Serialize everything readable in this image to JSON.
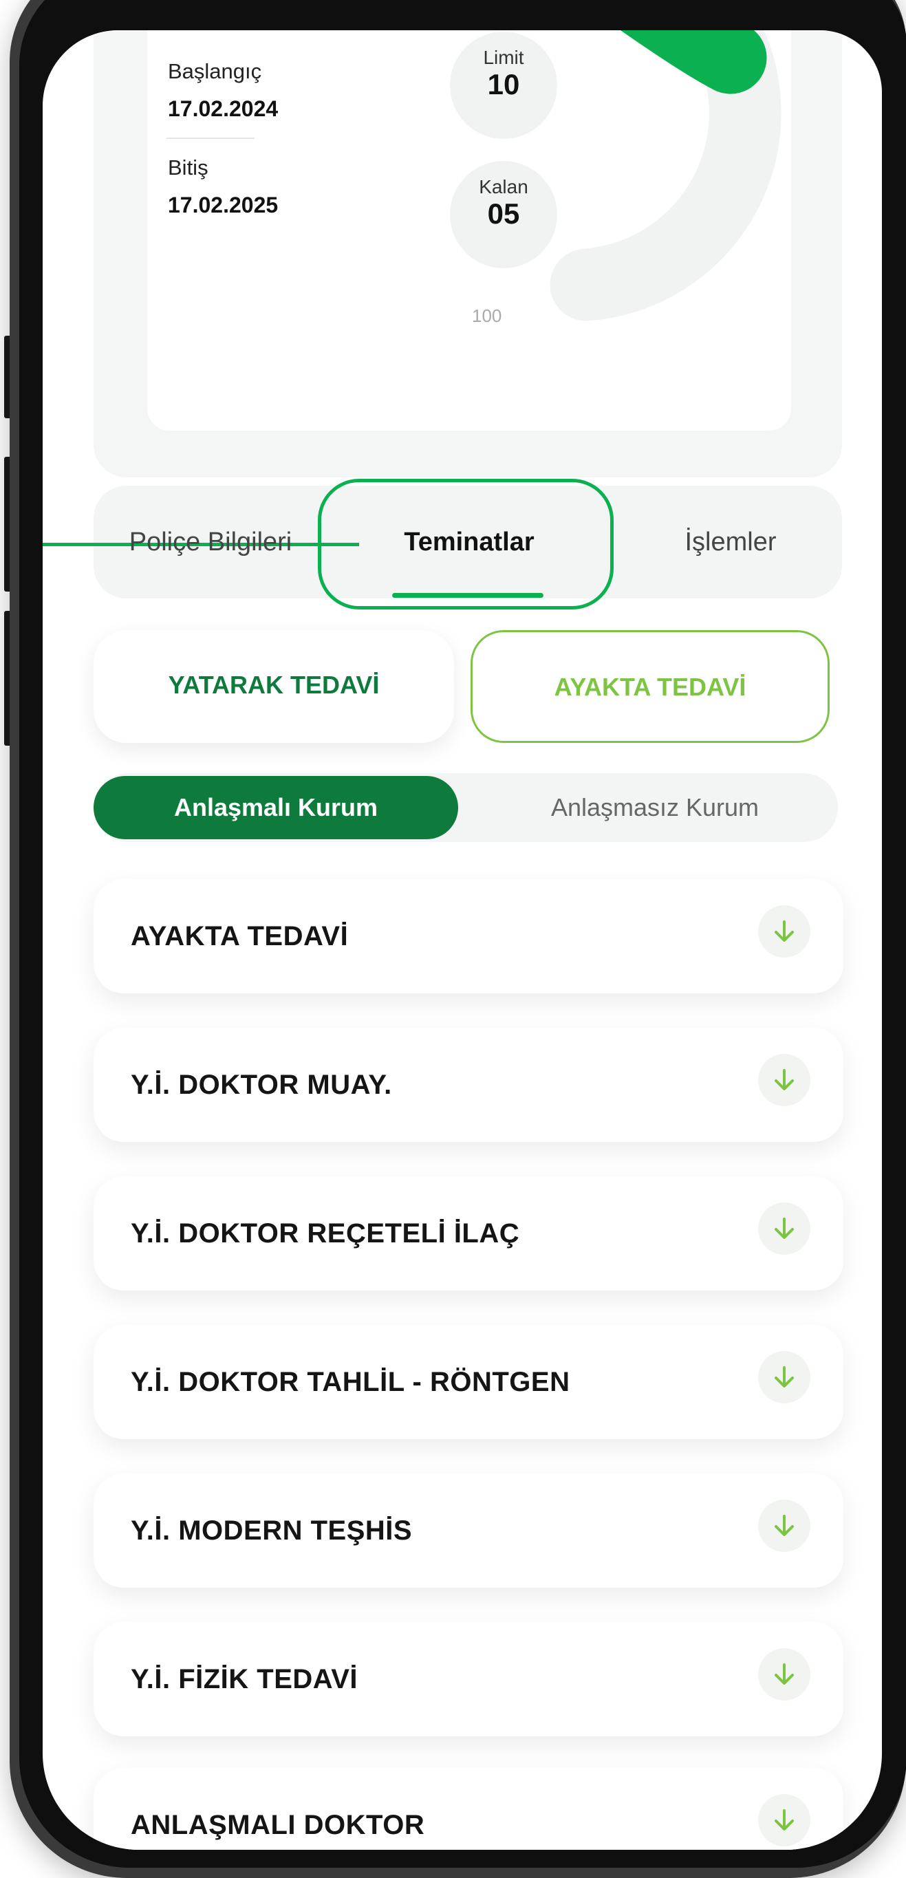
{
  "policy": {
    "start_label": "Başlangıç",
    "start_date": "17.02.2024",
    "end_label": "Bitiş",
    "end_date": "17.02.2025",
    "limit_label": "Limit",
    "limit_value": "10",
    "remaining_label": "Kalan",
    "remaining_value": "05",
    "gauge_max_label": "100",
    "gauge_fill_fraction": 0.15
  },
  "tabs": [
    {
      "label": "Poliçe Bilgileri",
      "active": false
    },
    {
      "label": "Teminatlar",
      "active": true
    },
    {
      "label": "İşlemler",
      "active": false
    }
  ],
  "treatment": {
    "inpatient_label": "YATARAK TEDAVİ",
    "outpatient_label": "AYAKTA TEDAVİ",
    "selected": "AYAKTA TEDAVİ"
  },
  "institution": {
    "contracted_label": "Anlaşmalı Kurum",
    "non_contracted_label": "Anlaşmasız Kurum",
    "selected": "Anlaşmalı Kurum"
  },
  "coverages": [
    {
      "label": "AYAKTA TEDAVİ"
    },
    {
      "label": "Y.İ. DOKTOR MUAY."
    },
    {
      "label": "Y.İ. DOKTOR REÇETELİ İLAÇ"
    },
    {
      "label": "Y.İ. DOKTOR TAHLİL - RÖNTGEN"
    },
    {
      "label": "Y.İ. MODERN TEŞHİS"
    },
    {
      "label": "Y.İ. FİZİK TEDAVİ"
    },
    {
      "label": "ANLAŞMALI DOKTOR"
    }
  ],
  "colors": {
    "brand_green": "#0e7a3c",
    "accent_green": "#0bb050",
    "light_green": "#7cc442"
  },
  "icons": [
    "arrow-down-icon"
  ]
}
